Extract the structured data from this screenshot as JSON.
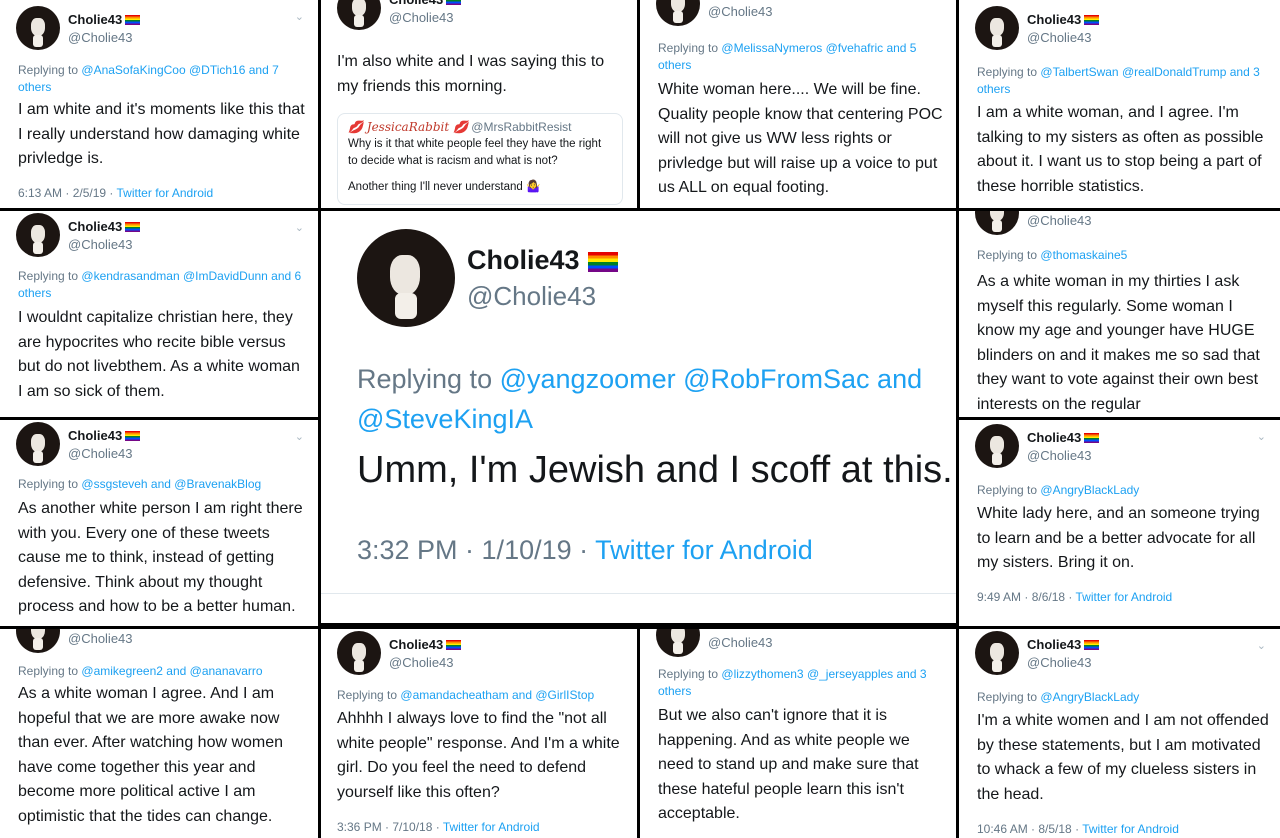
{
  "user": {
    "display_name": "Cholie43",
    "handle": "@Cholie43",
    "avatar_icon": "dog-avatar-icon"
  },
  "chevron_glyph": "⌄",
  "tiles": {
    "t1": {
      "reply_prefix": "Replying to",
      "reply_to": "@AnaSofaKingCoo @DTich16 and 7 others",
      "text": "I am white and it's moments like this that I really understand how damaging white privledge is.",
      "time": "6:13 AM · 2/5/19 · ",
      "source": "Twitter for Android"
    },
    "t2": {
      "text": "I'm also white and I was saying this to my friends this morning.",
      "quote_name": "💋 JessicaRabbit 💋",
      "quote_handle": "@MrsRabbitResist",
      "quote_text": "Why is it that white people feel they have the right to decide what is racism and what is not?",
      "quote_text2": "Another thing I'll never understand 🤷‍♀️"
    },
    "t3": {
      "reply_prefix": "Replying to",
      "reply_to": "@MelissaNymeros @fvehafric and 5 others",
      "text": "White woman here.... We will be fine. Quality people know that centering POC will not give us WW less rights or privledge but will raise up a voice to put us ALL on equal footing."
    },
    "t4": {
      "reply_prefix": "Replying to",
      "reply_to": "@TalbertSwan @realDonaldTrump and 3 others",
      "text": "I am a white woman, and I agree. I'm talking to my sisters as often as possible about it. I want us to stop being a part of these horrible statistics."
    },
    "t5": {
      "reply_prefix": "Replying to",
      "reply_to": "@kendrasandman @ImDavidDunn and 6 others",
      "text": "I wouldnt  capitalize christian here,  they are hypocrites who recite bible versus but do not livebthem.  As a white woman I am so sick of them."
    },
    "t6": {
      "reply_prefix": "Replying to",
      "reply_to": "@yangzoomer @RobFromSac and @SteveKingIA",
      "text": "Umm, I'm Jewish and I scoff at this.",
      "time": "3:32 PM · 1/10/19 · ",
      "source": "Twitter for Android"
    },
    "t7": {
      "reply_prefix": "Replying to",
      "reply_to": "@thomaskaine5",
      "text": "As a white woman in my thirties I ask myself this regularly. Some woman I know my age and younger have HUGE blinders on and it makes me so sad that they want to vote against their own best interests on the regular"
    },
    "t8": {
      "reply_prefix": "Replying to",
      "reply_to": "@ssgsteveh and @BravenakBlog",
      "text": "As another white person I am right there with you.  Every one of these tweets cause me to think, instead of getting defensive. Think about my thought process and how to be a better human."
    },
    "t9": {
      "reply_prefix": "Replying to",
      "reply_to": "@AngryBlackLady",
      "text": "White lady here, and an someone trying to learn and be a better advocate for all my sisters. Bring it on.",
      "time": "9:49 AM · 8/6/18 · ",
      "source": "Twitter for Android"
    },
    "t10": {
      "reply_prefix": "Replying to",
      "reply_to": "@amikegreen2 and @ananavarro",
      "text": "As a white woman I agree. And I am hopeful that we are more awake now than ever.  After watching how women have come together this year and become more political active I am optimistic that the tides can change."
    },
    "t11": {
      "reply_prefix": "Replying to",
      "reply_to": "@amandacheatham and @GirlIStop",
      "text": "Ahhhh I always love to find the \"not all white people\" response.  And I'm a white girl. Do you feel the need to defend yourself like this often?",
      "time": "3:36 PM · 7/10/18 · ",
      "source": "Twitter for Android"
    },
    "t12": {
      "reply_prefix": "Replying to",
      "reply_to": "@lizzythomen3 @_jerseyapples and 3 others",
      "text": "But we also can't ignore that it is happening. And as white people we need to stand up and make sure that these hateful people learn this isn't acceptable."
    },
    "t13": {
      "reply_prefix": "Replying to",
      "reply_to": "@AngryBlackLady",
      "text": "I'm a white women and I am not offended by these statements, but I am motivated to whack a few of my clueless sisters in the head.",
      "time": "10:46 AM · 8/5/18 · ",
      "source": "Twitter for Android"
    }
  }
}
